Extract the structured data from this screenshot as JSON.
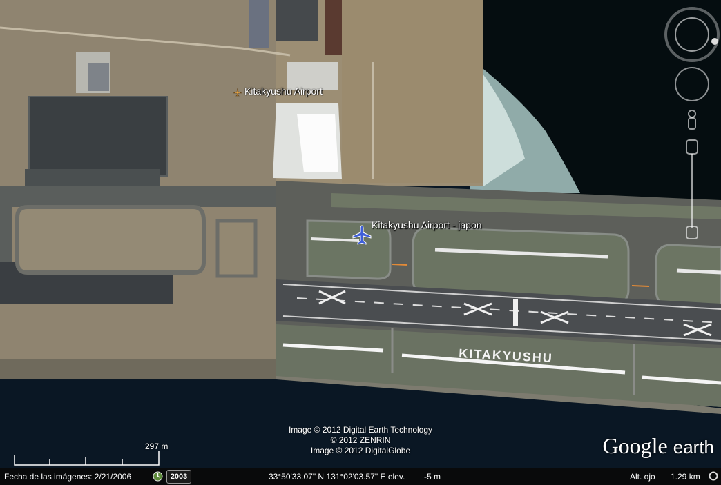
{
  "places": {
    "airport_label": "Kitakyushu Airport",
    "airport_pin_label": "Kitakyushu Airport - japon",
    "runway_text": "KITAKYUSHU"
  },
  "credits": {
    "line1": "Image © 2012 Digital Earth Technology",
    "line2": "© 2012 ZENRIN",
    "line3": "Image © 2012 DigitalGlobe"
  },
  "logo": {
    "google": "Google",
    "earth": "earth"
  },
  "scale": {
    "label": "297 m"
  },
  "status": {
    "imagery_date": "Fecha de las imágenes: 2/21/2006",
    "year_button": "2003",
    "coordinates": "33°50'33.07\" N 131°02'03.57\" E elev.",
    "elevation": "-5 m",
    "eye_alt_label": "Alt. ojo",
    "eye_alt_value": "1.29 km"
  },
  "icons": {
    "airplane_pin": "airplane-icon",
    "airport_small": "airport-icon",
    "historical_imagery": "clock-icon",
    "compass": "compass-icon",
    "look_control": "look-control-icon",
    "street_view": "pegman-icon",
    "zoom_slider": "zoom-slider-icon",
    "status_indicator": "streaming-indicator-icon"
  }
}
